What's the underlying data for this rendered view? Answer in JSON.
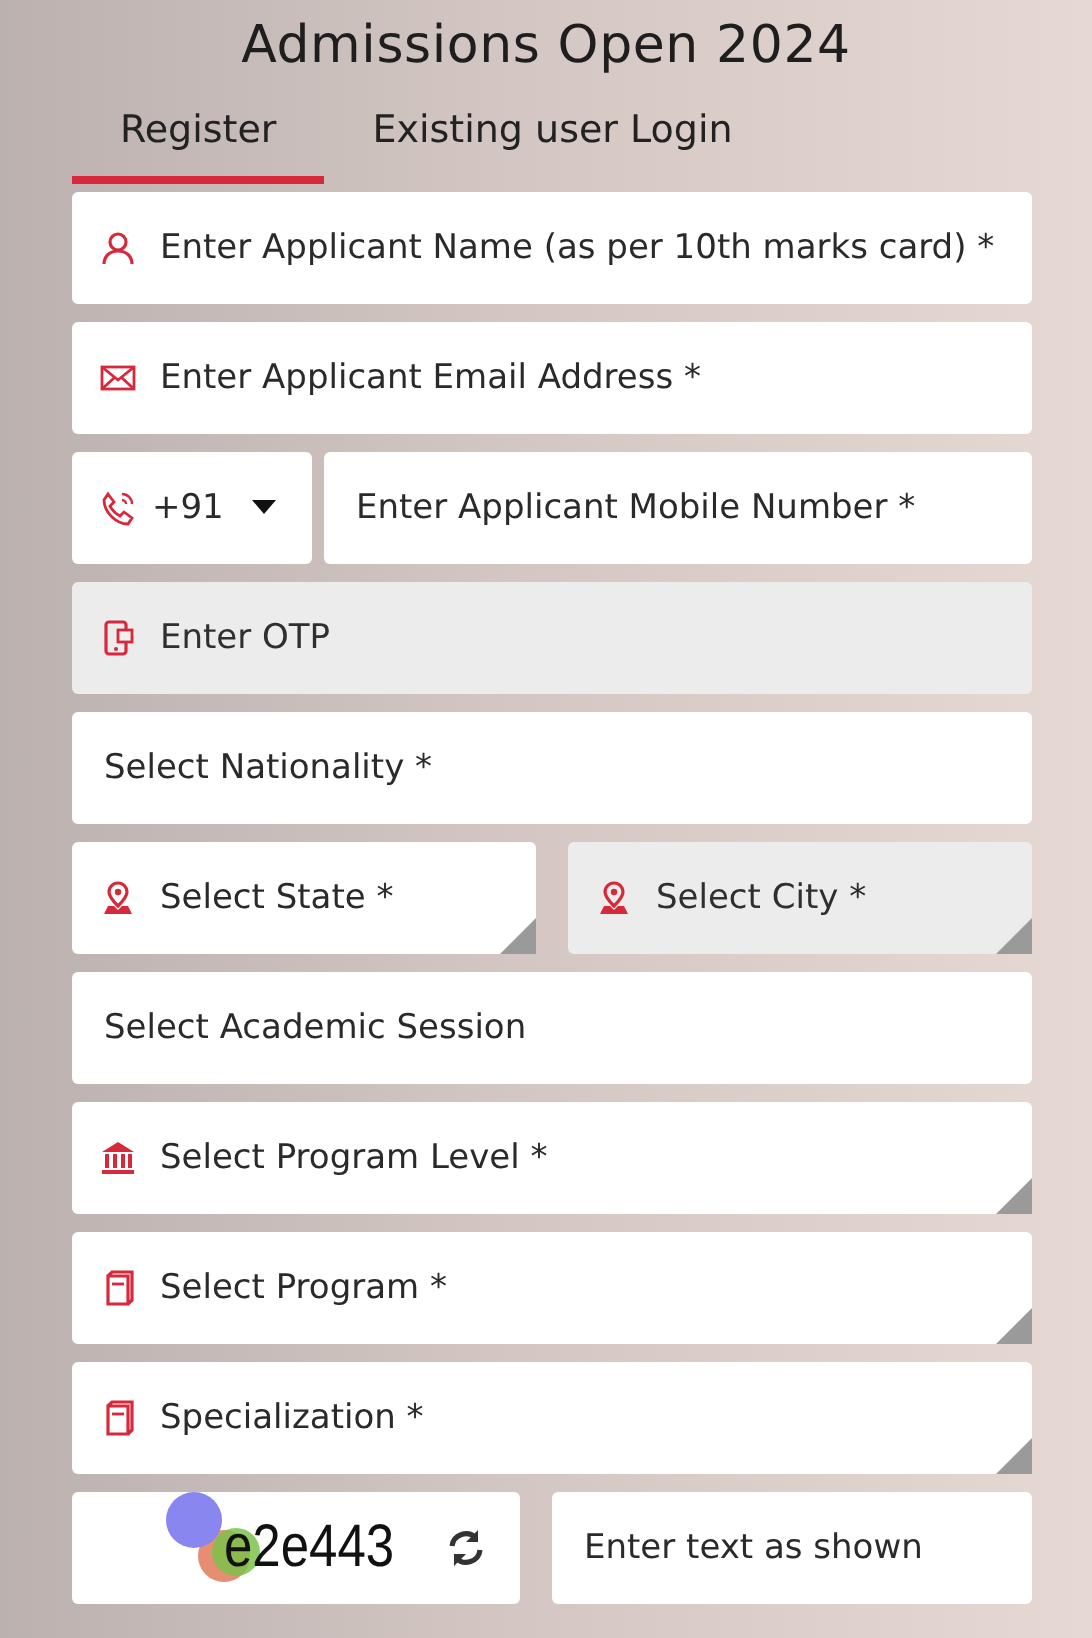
{
  "title": "Admissions Open 2024",
  "tabs": [
    {
      "label": "Register",
      "selected": true
    },
    {
      "label": "Existing user Login",
      "selected": false
    }
  ],
  "rows": [
    {
      "fields": [
        {
          "kind": "name",
          "placeholder": "Enter Applicant Name (as per 10th marks card) *",
          "disabled": false
        }
      ]
    },
    {
      "fields": [
        {
          "kind": "email",
          "placeholder": "Enter Applicant Email Address *",
          "disabled": false
        }
      ]
    },
    {
      "fields": [
        {
          "kind": "code",
          "value": "+91"
        },
        {
          "kind": "mobile",
          "placeholder": "Enter Applicant Mobile Number *",
          "disabled": false
        }
      ]
    },
    {
      "fields": [
        {
          "kind": "otp",
          "placeholder": "Enter OTP",
          "disabled": true
        }
      ]
    },
    {
      "fields": [
        {
          "kind": "nationality",
          "placeholder": "Select Nationality *",
          "disabled": false
        }
      ]
    },
    {
      "fields": [
        {
          "kind": "state",
          "placeholder": "Select State *",
          "disabled": false
        },
        {
          "kind": "city",
          "placeholder": "Select City *",
          "disabled": true
        }
      ]
    },
    {
      "fields": [
        {
          "kind": "session",
          "placeholder": "Select Academic Session",
          "disabled": false
        }
      ]
    },
    {
      "fields": [
        {
          "kind": "level",
          "placeholder": "Select Program Level *",
          "disabled": false
        }
      ]
    },
    {
      "fields": [
        {
          "kind": "program",
          "placeholder": "Select Program *",
          "disabled": false
        }
      ]
    },
    {
      "fields": [
        {
          "kind": "specialization",
          "placeholder": "Specialization *",
          "disabled": false
        }
      ]
    },
    {
      "fields": [
        {
          "kind": "captcha",
          "code": "e2e443"
        },
        {
          "kind": "answer",
          "placeholder": "Enter text as shown",
          "disabled": false
        }
      ]
    }
  ]
}
